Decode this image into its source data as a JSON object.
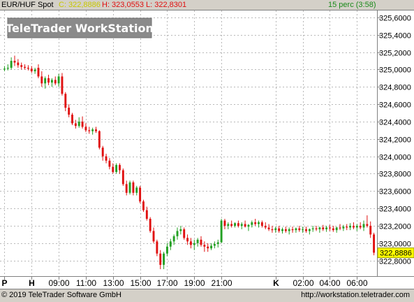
{
  "header": {
    "instrument": "EUR/HUF Spot",
    "close_label": "C:",
    "close_value": "322,8886",
    "hl_text": "H: 323,0553 L: 322,8301",
    "interval": "15 perc (3:58)"
  },
  "watermark": "TeleTrader WorkStation",
  "footer": {
    "copyright": "© 2019 TeleTrader Software GmbH",
    "url": "http://workstation.teletrader.com"
  },
  "colors": {
    "up": "#22a022",
    "down": "#e01010",
    "price_box": "#ffff00",
    "close_text": "#c8c800",
    "hl_text": "#e01010",
    "interval_text": "#1a8a1a"
  },
  "chart_data": {
    "type": "candlestick",
    "ylim": [
      322.62,
      325.68
    ],
    "yticks": [
      "325,6000",
      "325,4000",
      "325,2000",
      "325,0000",
      "324,8000",
      "324,6000",
      "324,4000",
      "324,2000",
      "324,0000",
      "323,8000",
      "323,6000",
      "323,4000",
      "323,2000",
      "323,0000",
      "322,8000"
    ],
    "ytick_values": [
      325.6,
      325.4,
      325.2,
      325.0,
      324.8,
      324.6,
      324.4,
      324.2,
      324.0,
      323.8,
      323.6,
      323.4,
      323.2,
      323.0,
      322.8
    ],
    "last_price": "322,8886",
    "last_value": 322.8886,
    "xticks": [
      {
        "label": "P",
        "i": 0
      },
      {
        "label": "H",
        "i": 8
      },
      {
        "label": "09:00",
        "i": 16
      },
      {
        "label": "11:00",
        "i": 24
      },
      {
        "label": "13:00",
        "i": 32
      },
      {
        "label": "15:00",
        "i": 40
      },
      {
        "label": "17:00",
        "i": 48
      },
      {
        "label": "19:00",
        "i": 56
      },
      {
        "label": "21:00",
        "i": 64
      },
      {
        "label": "K",
        "i": 80
      },
      {
        "label": "02:00",
        "i": 88
      },
      {
        "label": "04:00",
        "i": 96
      },
      {
        "label": "06:00",
        "i": 104
      }
    ],
    "candles": [
      [
        325.0,
        325.04,
        324.98,
        325.01
      ],
      [
        325.01,
        325.06,
        324.99,
        325.02
      ],
      [
        325.02,
        325.14,
        325.0,
        325.1
      ],
      [
        325.1,
        325.16,
        325.04,
        325.08
      ],
      [
        325.08,
        325.12,
        325.02,
        325.05
      ],
      [
        325.05,
        325.08,
        325.0,
        325.03
      ],
      [
        325.03,
        325.06,
        325.0,
        325.02
      ],
      [
        325.02,
        325.05,
        324.99,
        325.01
      ],
      [
        325.01,
        325.04,
        324.96,
        324.98
      ],
      [
        324.98,
        325.02,
        324.95,
        325.0
      ],
      [
        325.02,
        325.06,
        324.9,
        324.92
      ],
      [
        324.92,
        324.98,
        324.8,
        324.84
      ],
      [
        324.84,
        324.92,
        324.78,
        324.9
      ],
      [
        324.9,
        324.94,
        324.82,
        324.85
      ],
      [
        324.85,
        324.9,
        324.8,
        324.88
      ],
      [
        324.88,
        324.92,
        324.82,
        324.84
      ],
      [
        324.84,
        324.95,
        324.8,
        324.92
      ],
      [
        324.92,
        324.96,
        324.7,
        324.72
      ],
      [
        324.72,
        324.74,
        324.52,
        324.56
      ],
      [
        324.56,
        324.6,
        324.45,
        324.48
      ],
      [
        324.48,
        324.5,
        324.36,
        324.38
      ],
      [
        324.38,
        324.42,
        324.32,
        324.35
      ],
      [
        324.35,
        324.45,
        324.33,
        324.4
      ],
      [
        324.4,
        324.46,
        324.32,
        324.34
      ],
      [
        324.34,
        324.38,
        324.28,
        324.3
      ],
      [
        324.3,
        324.34,
        324.26,
        324.29
      ],
      [
        324.29,
        324.33,
        324.25,
        324.31
      ],
      [
        324.31,
        324.34,
        324.27,
        324.29
      ],
      [
        324.29,
        324.3,
        324.08,
        324.1
      ],
      [
        324.1,
        324.12,
        323.95,
        324.0
      ],
      [
        324.0,
        324.03,
        323.92,
        323.95
      ],
      [
        323.95,
        323.98,
        323.85,
        323.88
      ],
      [
        323.88,
        323.92,
        323.8,
        323.82
      ],
      [
        323.82,
        323.92,
        323.8,
        323.9
      ],
      [
        323.9,
        323.92,
        323.8,
        323.84
      ],
      [
        323.84,
        323.86,
        323.66,
        323.68
      ],
      [
        323.68,
        323.72,
        323.55,
        323.58
      ],
      [
        323.58,
        323.72,
        323.56,
        323.7
      ],
      [
        323.7,
        323.72,
        323.55,
        323.58
      ],
      [
        323.58,
        323.66,
        323.55,
        323.64
      ],
      [
        323.64,
        323.66,
        323.46,
        323.48
      ],
      [
        323.48,
        323.5,
        323.36,
        323.38
      ],
      [
        323.38,
        323.42,
        323.26,
        323.28
      ],
      [
        323.28,
        323.3,
        323.12,
        323.14
      ],
      [
        323.14,
        323.18,
        323.0,
        323.02
      ],
      [
        323.02,
        323.04,
        322.85,
        322.88
      ],
      [
        322.88,
        322.92,
        322.7,
        322.75
      ],
      [
        322.75,
        322.9,
        322.7,
        322.88
      ],
      [
        322.88,
        323.0,
        322.85,
        322.96
      ],
      [
        322.96,
        323.05,
        322.92,
        323.02
      ],
      [
        323.02,
        323.1,
        322.98,
        323.08
      ],
      [
        323.08,
        323.18,
        323.04,
        323.14
      ],
      [
        323.14,
        323.2,
        323.1,
        323.16
      ],
      [
        323.16,
        323.18,
        323.04,
        323.06
      ],
      [
        323.06,
        323.1,
        322.98,
        323.02
      ],
      [
        323.02,
        323.06,
        322.94,
        322.98
      ],
      [
        322.98,
        323.04,
        322.92,
        323.0
      ],
      [
        323.0,
        323.06,
        322.96,
        323.04
      ],
      [
        323.04,
        323.08,
        322.96,
        322.98
      ],
      [
        322.98,
        323.02,
        322.9,
        322.96
      ],
      [
        322.96,
        323.0,
        322.9,
        322.94
      ],
      [
        322.94,
        323.0,
        322.92,
        322.97
      ],
      [
        322.97,
        323.02,
        322.94,
        322.99
      ],
      [
        322.99,
        323.04,
        322.95,
        323.01
      ],
      [
        323.01,
        323.28,
        323.0,
        323.26
      ],
      [
        323.26,
        323.28,
        323.16,
        323.2
      ],
      [
        323.2,
        323.24,
        323.16,
        323.22
      ],
      [
        323.22,
        323.26,
        323.18,
        323.2
      ],
      [
        323.2,
        323.24,
        323.18,
        323.23
      ],
      [
        323.23,
        323.26,
        323.18,
        323.2
      ],
      [
        323.2,
        323.24,
        323.16,
        323.22
      ],
      [
        323.22,
        323.26,
        323.18,
        323.19
      ],
      [
        323.19,
        323.22,
        323.14,
        323.21
      ],
      [
        323.21,
        323.26,
        323.18,
        323.24
      ],
      [
        323.24,
        323.28,
        323.2,
        323.22
      ],
      [
        323.22,
        323.26,
        323.18,
        323.24
      ],
      [
        323.24,
        323.26,
        323.18,
        323.2
      ],
      [
        323.2,
        323.24,
        323.16,
        323.18
      ],
      [
        323.18,
        323.22,
        323.14,
        323.16
      ],
      [
        323.16,
        323.2,
        323.12,
        323.15
      ],
      [
        323.15,
        323.19,
        323.12,
        323.17
      ],
      [
        323.17,
        323.2,
        323.12,
        323.14
      ],
      [
        323.14,
        323.18,
        323.11,
        323.16
      ],
      [
        323.16,
        323.19,
        323.12,
        323.14
      ],
      [
        323.14,
        323.18,
        323.1,
        323.16
      ],
      [
        323.16,
        323.19,
        323.12,
        323.15
      ],
      [
        323.15,
        323.18,
        323.12,
        323.17
      ],
      [
        323.17,
        323.2,
        323.13,
        323.15
      ],
      [
        323.15,
        323.19,
        323.12,
        323.16
      ],
      [
        323.16,
        323.19,
        323.12,
        323.14
      ],
      [
        323.14,
        323.17,
        323.1,
        323.16
      ],
      [
        323.16,
        323.2,
        323.13,
        323.17
      ],
      [
        323.17,
        323.2,
        323.14,
        323.16
      ],
      [
        323.16,
        323.19,
        323.12,
        323.18
      ],
      [
        323.18,
        323.21,
        323.14,
        323.16
      ],
      [
        323.16,
        323.2,
        323.13,
        323.18
      ],
      [
        323.18,
        323.21,
        323.14,
        323.17
      ],
      [
        323.17,
        323.2,
        323.13,
        323.15
      ],
      [
        323.15,
        323.19,
        323.12,
        323.18
      ],
      [
        323.18,
        323.22,
        323.15,
        323.17
      ],
      [
        323.17,
        323.21,
        323.14,
        323.19
      ],
      [
        323.19,
        323.22,
        323.15,
        323.18
      ],
      [
        323.18,
        323.23,
        323.15,
        323.2
      ],
      [
        323.2,
        323.24,
        323.16,
        323.18
      ],
      [
        323.18,
        323.22,
        323.14,
        323.2
      ],
      [
        323.2,
        323.24,
        323.16,
        323.18
      ],
      [
        323.18,
        323.26,
        323.14,
        323.22
      ],
      [
        323.22,
        323.32,
        323.18,
        323.2
      ],
      [
        323.2,
        323.25,
        323.06,
        323.1
      ],
      [
        323.1,
        323.12,
        322.86,
        322.89
      ]
    ]
  }
}
